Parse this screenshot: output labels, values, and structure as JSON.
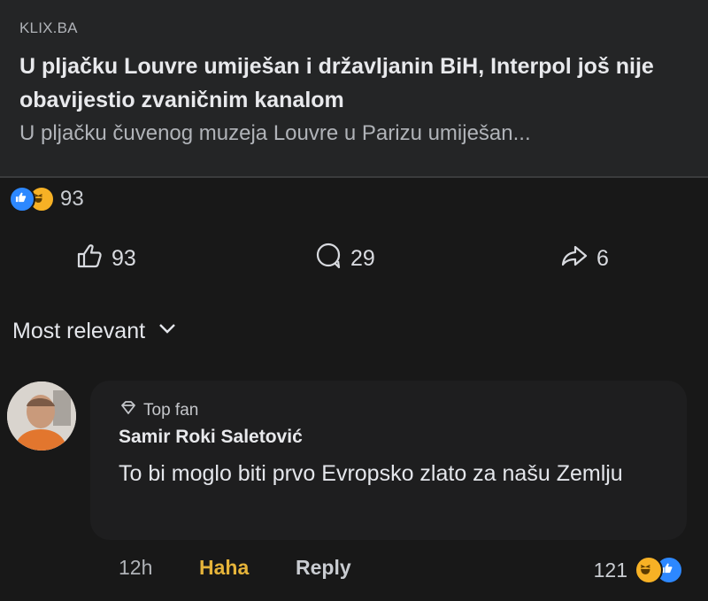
{
  "post": {
    "link_card": {
      "source": "KLIX.BA",
      "title": "U pljačku Louvre umiješan i državljanin BiH, Interpol još nije obavijestio zvaničnim kanalom",
      "description": "U pljačku čuvenog muzeja Louvre u Parizu umiješan..."
    },
    "reactions": {
      "types": [
        "like",
        "haha"
      ],
      "count": "93"
    },
    "actions": {
      "like": {
        "icon": "thumbs-up-icon",
        "count": "93"
      },
      "comment": {
        "icon": "comment-bubble-icon",
        "count": "29"
      },
      "share": {
        "icon": "share-arrow-icon",
        "count": "6"
      }
    }
  },
  "comments": {
    "sort_label": "Most relevant",
    "items": [
      {
        "badge": "Top fan",
        "author": "Samir Roki Saletović",
        "text": "To bi moglo biti prvo Evropsko zlato za našu Zemlju",
        "time": "12h",
        "user_reaction": "Haha",
        "reply_label": "Reply",
        "reaction_count": "121",
        "reaction_types": [
          "haha",
          "like"
        ]
      }
    ]
  },
  "colors": {
    "background": "#181818",
    "card": "#242526",
    "like_blue": "#2d88ff",
    "haha_yellow": "#f7b125",
    "haha_label": "#e6b43a"
  }
}
